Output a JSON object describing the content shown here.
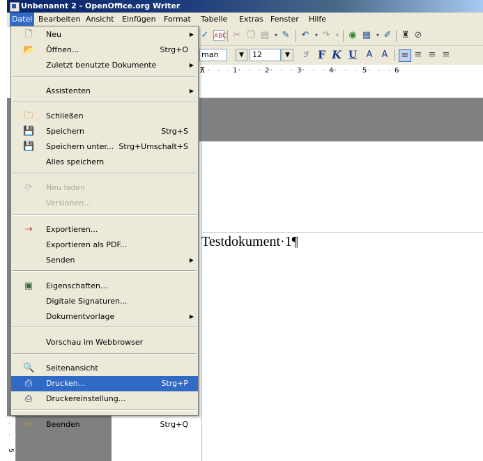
{
  "window": {
    "title": "Unbenannt 2 - OpenOffice.org Writer"
  },
  "menubar": [
    "Datei",
    "Bearbeiten",
    "Ansicht",
    "Einfügen",
    "Format",
    "Tabelle",
    "Extras",
    "Fenster",
    "Hilfe"
  ],
  "menu": [
    {
      "label": "Neu",
      "accel": "",
      "submenu": true,
      "disabled": false,
      "icon": "new-document-icon"
    },
    {
      "label": "Öffnen...",
      "accel": "Strg+O",
      "submenu": false,
      "disabled": false,
      "icon": "open-folder-icon"
    },
    {
      "label": "Zuletzt benutzte Dokumente",
      "accel": "",
      "submenu": true,
      "disabled": false,
      "icon": ""
    },
    {
      "label": "Assistenten",
      "accel": "",
      "submenu": true,
      "disabled": false,
      "icon": ""
    },
    {
      "label": "Schließen",
      "accel": "",
      "submenu": false,
      "disabled": false,
      "icon": "close-document-icon"
    },
    {
      "label": "Speichern",
      "accel": "Strg+S",
      "submenu": false,
      "disabled": false,
      "icon": "save-icon"
    },
    {
      "label": "Speichern unter...",
      "accel": "Strg+Umschalt+S",
      "submenu": false,
      "disabled": false,
      "icon": "save-as-icon"
    },
    {
      "label": "Alles speichern",
      "accel": "",
      "submenu": false,
      "disabled": false,
      "icon": ""
    },
    {
      "label": "Neu laden",
      "accel": "",
      "submenu": false,
      "disabled": true,
      "icon": "reload-icon"
    },
    {
      "label": "Versionen...",
      "accel": "",
      "submenu": false,
      "disabled": true,
      "icon": ""
    },
    {
      "label": "Exportieren...",
      "accel": "",
      "submenu": false,
      "disabled": false,
      "icon": "export-icon"
    },
    {
      "label": "Exportieren als PDF...",
      "accel": "",
      "submenu": false,
      "disabled": false,
      "icon": ""
    },
    {
      "label": "Senden",
      "accel": "",
      "submenu": true,
      "disabled": false,
      "icon": ""
    },
    {
      "label": "Eigenschaften...",
      "accel": "",
      "submenu": false,
      "disabled": false,
      "icon": "properties-icon"
    },
    {
      "label": "Digitale Signaturen...",
      "accel": "",
      "submenu": false,
      "disabled": false,
      "icon": ""
    },
    {
      "label": "Dokumentvorlage",
      "accel": "",
      "submenu": true,
      "disabled": false,
      "icon": ""
    },
    {
      "label": "Vorschau im Webbrowser",
      "accel": "",
      "submenu": false,
      "disabled": false,
      "icon": ""
    },
    {
      "label": "Seitenansicht",
      "accel": "",
      "submenu": false,
      "disabled": false,
      "icon": "page-preview-icon"
    },
    {
      "label": "Drucken...",
      "accel": "Strg+P",
      "submenu": false,
      "disabled": false,
      "icon": "printer-icon",
      "highlight": true
    },
    {
      "label": "Druckereinstellung...",
      "accel": "",
      "submenu": false,
      "disabled": false,
      "icon": "printer-settings-icon"
    },
    {
      "label": "Beenden",
      "accel": "Strg+Q",
      "submenu": false,
      "disabled": false,
      "icon": "exit-icon"
    }
  ],
  "toolbar": {
    "font_name": "man",
    "font_size": "12",
    "bold": "F",
    "italic": "K",
    "underline": "U"
  },
  "ruler": [
    "1",
    "2",
    "3",
    "4",
    "5",
    "6"
  ],
  "document": {
    "text": "Testdokument·1¶"
  },
  "vruler_label": "5"
}
